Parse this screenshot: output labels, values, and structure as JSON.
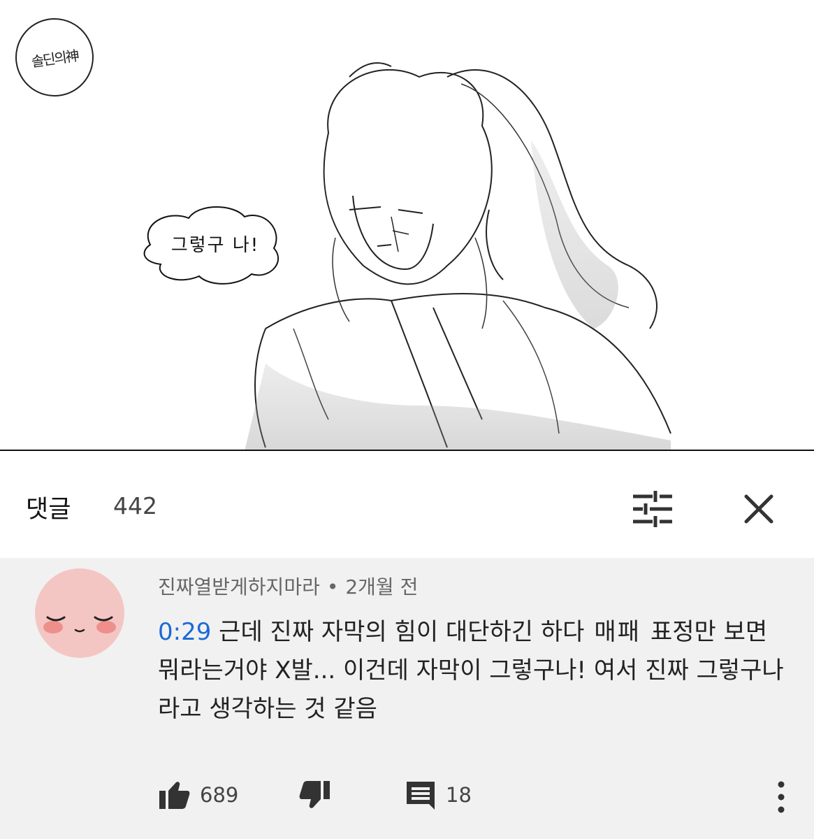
{
  "illustration": {
    "signature_text": "솔딘의神",
    "speech_bubble": "그렇구 나!"
  },
  "comments_header": {
    "title": "댓글",
    "count": "442",
    "sort_icon": "sort-sliders-icon",
    "close_icon": "close-icon"
  },
  "comment": {
    "author": "진짜열받게하지마라",
    "separator": "•",
    "posted": "2개월 전",
    "timestamp": "0:29",
    "text_part1": "근데 진짜 자막의 힘이 대단하긴 하다",
    "handwritten": "매패",
    "text_part2": "표정만 보면 뭐라는거야 X발... 이건데 자막이 그렇구나! 여서 진짜 그렇구나라고 생각하는 것 같음",
    "likes": "689",
    "replies": "18",
    "avatar_color": "#f4c6c3",
    "link_color": "#1a6ad8"
  }
}
